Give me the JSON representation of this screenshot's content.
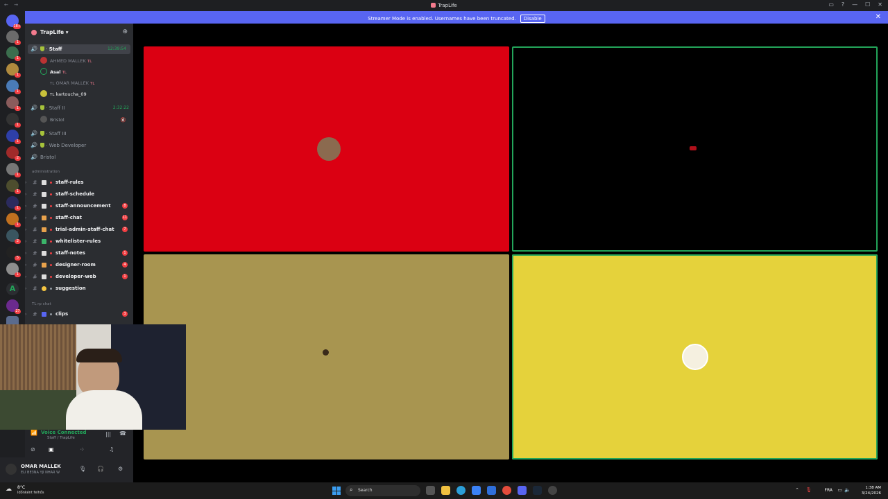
{
  "window": {
    "title": "TrapLife",
    "controls": [
      "▭",
      "?",
      "—",
      "☐",
      "✕"
    ]
  },
  "banner": {
    "message": "Streamer Mode is enabled. Usernames have been truncated.",
    "disable_label": "Disable",
    "close_glyph": "✕"
  },
  "server": {
    "name": "TrapLife",
    "chevron": "▾"
  },
  "voice_channels": {
    "staff": {
      "label": "Staff",
      "timer": "12:39:54"
    },
    "staff_members": [
      {
        "name": "AHMED MALLEK",
        "tag": "TL"
      },
      {
        "name": "Asal",
        "tag": "TL"
      },
      {
        "name": "OMAR MALLEK",
        "tag": "TL"
      },
      {
        "name": "kartoucha_09",
        "tag": "TL"
      }
    ],
    "staff2": {
      "label": "Staff II",
      "timer": "2:32:22"
    },
    "staff2_members": [
      {
        "name": "Bristol"
      }
    ],
    "staff3": {
      "label": "Staff III"
    },
    "webdev": {
      "label": "Web Developer"
    },
    "bristol": {
      "label": "Bristol"
    }
  },
  "categories": {
    "administration": "administration",
    "rp_chat": "TL rp chat"
  },
  "text_channels": [
    {
      "name": "staff-rules",
      "badge": ""
    },
    {
      "name": "staff-schedule",
      "badge": ""
    },
    {
      "name": "staff-announcement",
      "badge": "8"
    },
    {
      "name": "staff-chat",
      "badge": "11"
    },
    {
      "name": "trial-admin-staff-chat",
      "badge": "7"
    },
    {
      "name": "whitelister-rules",
      "badge": ""
    },
    {
      "name": "staff-notes",
      "badge": "1"
    },
    {
      "name": "designer-room",
      "badge": "4"
    },
    {
      "name": "developer-web",
      "badge": "1"
    },
    {
      "name": "suggestion",
      "badge": ""
    }
  ],
  "clips_channel": {
    "name": "clips",
    "badge": "3"
  },
  "voice_panel": {
    "status": "Voice Connected",
    "location": "Staff / TrapLife"
  },
  "user_panel": {
    "name": "OMAR MALLEK",
    "status": "ELI BE3NA YJI NHAR W"
  },
  "server_badges": [
    "1",
    "1",
    "1",
    "1",
    "1",
    "1",
    "1",
    "2",
    "1",
    "1",
    "1",
    "1",
    "2",
    "5",
    "1",
    "1",
    "1",
    "27"
  ],
  "server_letter": "A",
  "top_badge": "18+",
  "tiles": [
    {
      "user": "tile-1",
      "bg": "#db0012",
      "speaking": false
    },
    {
      "user": "tile-2",
      "bg": "#000000",
      "speaking": true
    },
    {
      "user": "tile-3",
      "bg": "#a89550",
      "speaking": false
    },
    {
      "user": "tile-4",
      "bg": "#e5d23b",
      "speaking": true
    }
  ],
  "taskbar": {
    "temperature": "8°C",
    "weather": "Időnként felhős",
    "search": "Search",
    "language": "FRA",
    "time": "1:38 AM",
    "date": "3/24/2026"
  },
  "colors": {
    "accent": "#5865f2",
    "speaking": "#23a55a",
    "mention": "#f23f43"
  }
}
